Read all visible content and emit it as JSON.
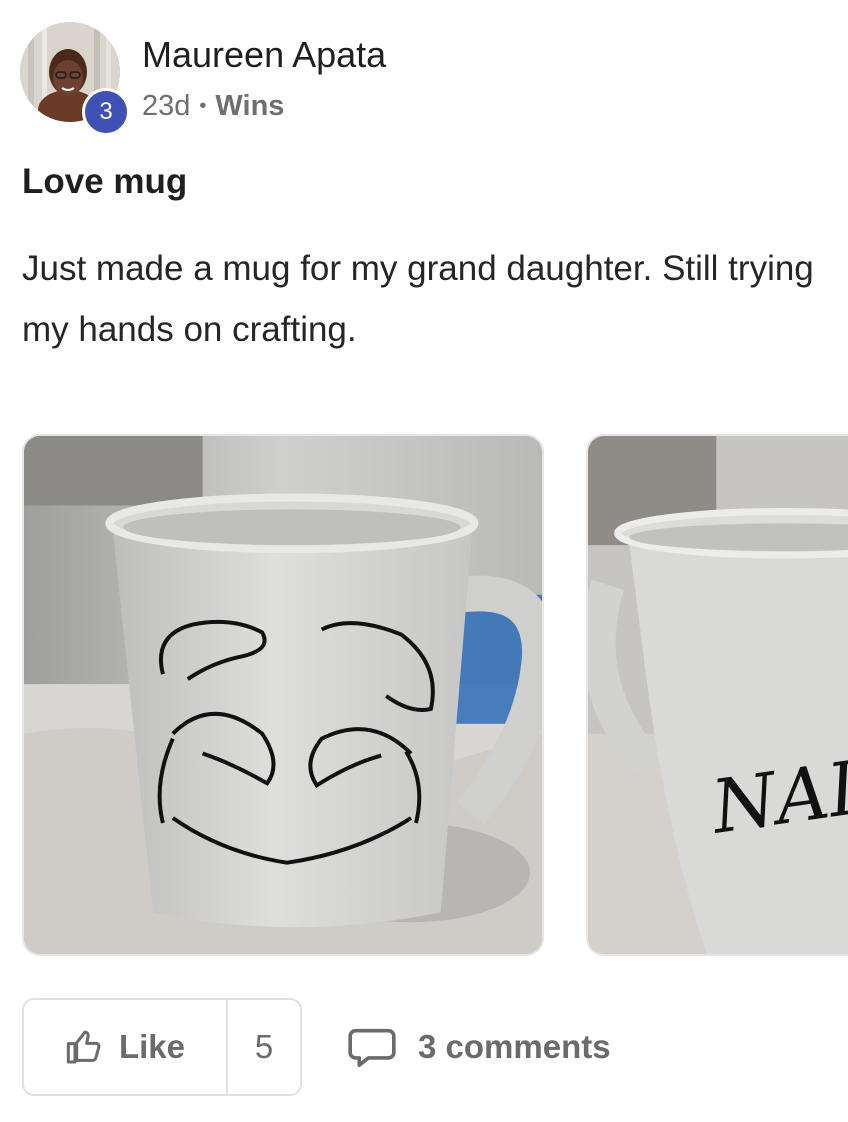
{
  "post": {
    "author": {
      "name": "Maureen Apata",
      "level": "3"
    },
    "meta": {
      "age": "23d",
      "separator": "•",
      "category": "Wins"
    },
    "title": "Love mug",
    "body": "Just made a mug for my grand daughter. Still trying my hands on crafting.",
    "images": [
      {
        "subject": "white mug with hand-heart drawing"
      },
      {
        "subject": "white mug with lettering"
      }
    ],
    "actions": {
      "like_label": "Like",
      "like_count": "5",
      "comments_label": "3 comments"
    }
  },
  "icons": {
    "like": "thumbs-up-icon",
    "comment": "speech-bubble-icon"
  },
  "colors": {
    "badge": "#3f51b5",
    "text_primary": "#1f1f1f",
    "text_muted": "#6f6f6f",
    "border": "#e1e1e1"
  }
}
